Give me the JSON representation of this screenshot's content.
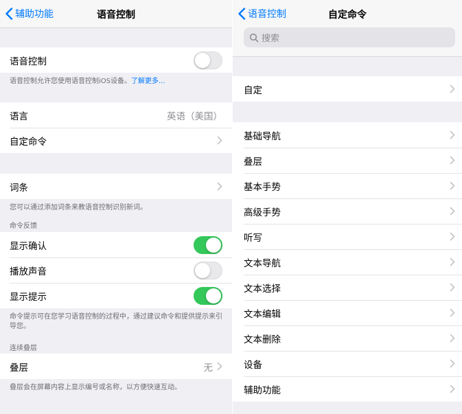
{
  "left": {
    "back_label": "辅助功能",
    "title": "语音控制",
    "voice_control": {
      "label": "语音控制",
      "enabled": false
    },
    "voice_control_footer": "语音控制允许您使用语音控制iOS设备。",
    "learn_more": "了解更多...",
    "language": {
      "label": "语言",
      "value": "英语（美国）"
    },
    "custom_commands": {
      "label": "自定命令"
    },
    "vocabulary": {
      "label": "词条"
    },
    "vocabulary_footer": "您可以通过添加词条来教语音控制识别新词。",
    "feedback_header": "命令反馈",
    "show_confirmation": {
      "label": "显示确认",
      "enabled": true
    },
    "play_sound": {
      "label": "播放声音",
      "enabled": false
    },
    "show_hints": {
      "label": "显示提示",
      "enabled": true
    },
    "hints_footer": "命令提示可在您学习语音控制的过程中，通过建议命令和提供提示来引导您。",
    "overlay_header": "连续叠层",
    "overlay": {
      "label": "叠层",
      "value": "无"
    },
    "overlay_footer": "叠层会在屏幕内容上显示编号或名称，以方便快速互动。"
  },
  "right": {
    "back_label": "语音控制",
    "title": "自定命令",
    "search_placeholder": "搜索",
    "custom": {
      "label": "自定"
    },
    "categories": [
      "基础导航",
      "叠层",
      "基本手势",
      "高级手势",
      "听写",
      "文本导航",
      "文本选择",
      "文本编辑",
      "文本删除",
      "设备",
      "辅助功能"
    ]
  },
  "colors": {
    "accent": "#007aff",
    "toggle_on": "#34c759",
    "background": "#efeff4"
  }
}
